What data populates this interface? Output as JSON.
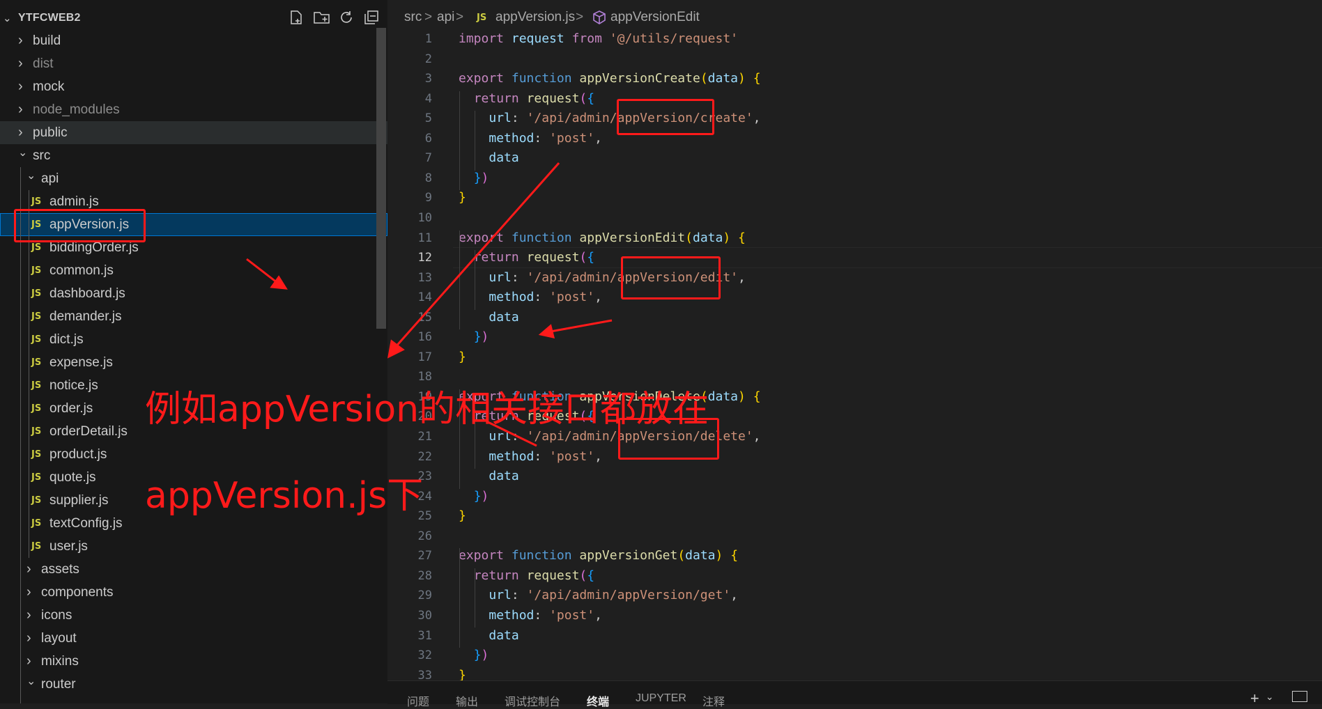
{
  "explorer": {
    "title": "YTFCWEB2",
    "actions": [
      "new-file-icon",
      "new-folder-icon",
      "refresh-icon",
      "collapse-all-icon"
    ],
    "items": [
      {
        "label": "build",
        "type": "folder",
        "expanded": false,
        "depth": 0
      },
      {
        "label": "dist",
        "type": "folder",
        "expanded": false,
        "depth": 0,
        "dim": true
      },
      {
        "label": "mock",
        "type": "folder",
        "expanded": false,
        "depth": 0
      },
      {
        "label": "node_modules",
        "type": "folder",
        "expanded": false,
        "depth": 0,
        "dim": true
      },
      {
        "label": "public",
        "type": "folder",
        "expanded": false,
        "depth": 0
      },
      {
        "label": "src",
        "type": "folder",
        "expanded": true,
        "depth": 0
      },
      {
        "label": "api",
        "type": "folder",
        "expanded": true,
        "depth": 1
      },
      {
        "label": "admin.js",
        "type": "js",
        "depth": 2
      },
      {
        "label": "appVersion.js",
        "type": "js",
        "depth": 2,
        "selected": true
      },
      {
        "label": "biddingOrder.js",
        "type": "js",
        "depth": 2
      },
      {
        "label": "common.js",
        "type": "js",
        "depth": 2
      },
      {
        "label": "dashboard.js",
        "type": "js",
        "depth": 2
      },
      {
        "label": "demander.js",
        "type": "js",
        "depth": 2
      },
      {
        "label": "dict.js",
        "type": "js",
        "depth": 2
      },
      {
        "label": "expense.js",
        "type": "js",
        "depth": 2
      },
      {
        "label": "notice.js",
        "type": "js",
        "depth": 2
      },
      {
        "label": "order.js",
        "type": "js",
        "depth": 2
      },
      {
        "label": "orderDetail.js",
        "type": "js",
        "depth": 2
      },
      {
        "label": "product.js",
        "type": "js",
        "depth": 2
      },
      {
        "label": "quote.js",
        "type": "js",
        "depth": 2
      },
      {
        "label": "supplier.js",
        "type": "js",
        "depth": 2
      },
      {
        "label": "textConfig.js",
        "type": "js",
        "depth": 2
      },
      {
        "label": "user.js",
        "type": "js",
        "depth": 2
      },
      {
        "label": "assets",
        "type": "folder",
        "expanded": false,
        "depth": 1
      },
      {
        "label": "components",
        "type": "folder",
        "expanded": false,
        "depth": 1
      },
      {
        "label": "icons",
        "type": "folder",
        "expanded": false,
        "depth": 1
      },
      {
        "label": "layout",
        "type": "folder",
        "expanded": false,
        "depth": 1
      },
      {
        "label": "mixins",
        "type": "folder",
        "expanded": false,
        "depth": 1
      },
      {
        "label": "router",
        "type": "folder",
        "expanded": true,
        "depth": 1
      }
    ],
    "js_badge": "JS",
    "icons": {
      "collapsed": "chevron-right-icon",
      "expanded": "chevron-down-icon",
      "file": "js-file-icon"
    }
  },
  "breadcrumb": {
    "parts": [
      "src",
      "api",
      "appVersion.js",
      "appVersionEdit"
    ],
    "separator": ">",
    "js_badge": "JS",
    "symbol_icon": "method-cube-icon"
  },
  "editor": {
    "current_line": 12,
    "lines": [
      [
        {
          "t": "import",
          "c": "k"
        },
        {
          "t": " request ",
          "c": "v"
        },
        {
          "t": "from",
          "c": "k"
        },
        {
          "t": " "
        },
        {
          "t": "'@/utils/request'",
          "c": "s"
        }
      ],
      [],
      [
        {
          "t": "export",
          "c": "k"
        },
        {
          "t": " "
        },
        {
          "t": "function",
          "c": "f"
        },
        {
          "t": " "
        },
        {
          "t": "appVersionCreate",
          "c": "fn"
        },
        {
          "t": "(",
          "c": "b1"
        },
        {
          "t": "data",
          "c": "v"
        },
        {
          "t": ")",
          "c": "b1"
        },
        {
          "t": " "
        },
        {
          "t": "{",
          "c": "b1"
        }
      ],
      [
        {
          "t": "  "
        },
        {
          "t": "return",
          "c": "k"
        },
        {
          "t": " "
        },
        {
          "t": "request",
          "c": "fn"
        },
        {
          "t": "(",
          "c": "b2"
        },
        {
          "t": "{",
          "c": "b3"
        }
      ],
      [
        {
          "t": "    "
        },
        {
          "t": "url",
          "c": "v"
        },
        {
          "t": ": "
        },
        {
          "t": "'/api/admin/appVersion/create'",
          "c": "s"
        },
        {
          "t": ","
        }
      ],
      [
        {
          "t": "    "
        },
        {
          "t": "method",
          "c": "v"
        },
        {
          "t": ": "
        },
        {
          "t": "'post'",
          "c": "s"
        },
        {
          "t": ","
        }
      ],
      [
        {
          "t": "    "
        },
        {
          "t": "data",
          "c": "v"
        }
      ],
      [
        {
          "t": "  "
        },
        {
          "t": "}",
          "c": "b3"
        },
        {
          "t": ")",
          "c": "b2"
        }
      ],
      [
        {
          "t": "}",
          "c": "b1"
        }
      ],
      [],
      [
        {
          "t": "export",
          "c": "k"
        },
        {
          "t": " "
        },
        {
          "t": "function",
          "c": "f"
        },
        {
          "t": " "
        },
        {
          "t": "appVersionEdit",
          "c": "fn"
        },
        {
          "t": "(",
          "c": "b1"
        },
        {
          "t": "data",
          "c": "v"
        },
        {
          "t": ")",
          "c": "b1"
        },
        {
          "t": " "
        },
        {
          "t": "{",
          "c": "b1"
        }
      ],
      [
        {
          "t": "  "
        },
        {
          "t": "return",
          "c": "k"
        },
        {
          "t": " "
        },
        {
          "t": "request",
          "c": "fn"
        },
        {
          "t": "(",
          "c": "b2"
        },
        {
          "t": "{",
          "c": "b3"
        }
      ],
      [
        {
          "t": "    "
        },
        {
          "t": "url",
          "c": "v"
        },
        {
          "t": ": "
        },
        {
          "t": "'/api/admin/appVersion/edit'",
          "c": "s"
        },
        {
          "t": ","
        }
      ],
      [
        {
          "t": "    "
        },
        {
          "t": "method",
          "c": "v"
        },
        {
          "t": ": "
        },
        {
          "t": "'post'",
          "c": "s"
        },
        {
          "t": ","
        }
      ],
      [
        {
          "t": "    "
        },
        {
          "t": "data",
          "c": "v"
        }
      ],
      [
        {
          "t": "  "
        },
        {
          "t": "}",
          "c": "b3"
        },
        {
          "t": ")",
          "c": "b2"
        }
      ],
      [
        {
          "t": "}",
          "c": "b1"
        }
      ],
      [],
      [
        {
          "t": "export",
          "c": "k"
        },
        {
          "t": " "
        },
        {
          "t": "function",
          "c": "f"
        },
        {
          "t": " "
        },
        {
          "t": "appVersionDelete",
          "c": "fn"
        },
        {
          "t": "(",
          "c": "b1"
        },
        {
          "t": "data",
          "c": "v"
        },
        {
          "t": ")",
          "c": "b1"
        },
        {
          "t": " "
        },
        {
          "t": "{",
          "c": "b1"
        }
      ],
      [
        {
          "t": "  "
        },
        {
          "t": "return",
          "c": "k"
        },
        {
          "t": " "
        },
        {
          "t": "request",
          "c": "fn"
        },
        {
          "t": "(",
          "c": "b2"
        },
        {
          "t": "{",
          "c": "b3"
        }
      ],
      [
        {
          "t": "    "
        },
        {
          "t": "url",
          "c": "v"
        },
        {
          "t": ": "
        },
        {
          "t": "'/api/admin/appVersion/delete'",
          "c": "s"
        },
        {
          "t": ","
        }
      ],
      [
        {
          "t": "    "
        },
        {
          "t": "method",
          "c": "v"
        },
        {
          "t": ": "
        },
        {
          "t": "'post'",
          "c": "s"
        },
        {
          "t": ","
        }
      ],
      [
        {
          "t": "    "
        },
        {
          "t": "data",
          "c": "v"
        }
      ],
      [
        {
          "t": "  "
        },
        {
          "t": "}",
          "c": "b3"
        },
        {
          "t": ")",
          "c": "b2"
        }
      ],
      [
        {
          "t": "}",
          "c": "b1"
        }
      ],
      [],
      [
        {
          "t": "export",
          "c": "k"
        },
        {
          "t": " "
        },
        {
          "t": "function",
          "c": "f"
        },
        {
          "t": " "
        },
        {
          "t": "appVersionGet",
          "c": "fn"
        },
        {
          "t": "(",
          "c": "b1"
        },
        {
          "t": "data",
          "c": "v"
        },
        {
          "t": ")",
          "c": "b1"
        },
        {
          "t": " "
        },
        {
          "t": "{",
          "c": "b1"
        }
      ],
      [
        {
          "t": "  "
        },
        {
          "t": "return",
          "c": "k"
        },
        {
          "t": " "
        },
        {
          "t": "request",
          "c": "fn"
        },
        {
          "t": "(",
          "c": "b2"
        },
        {
          "t": "{",
          "c": "b3"
        }
      ],
      [
        {
          "t": "    "
        },
        {
          "t": "url",
          "c": "v"
        },
        {
          "t": ": "
        },
        {
          "t": "'/api/admin/appVersion/get'",
          "c": "s"
        },
        {
          "t": ","
        }
      ],
      [
        {
          "t": "    "
        },
        {
          "t": "method",
          "c": "v"
        },
        {
          "t": ": "
        },
        {
          "t": "'post'",
          "c": "s"
        },
        {
          "t": ","
        }
      ],
      [
        {
          "t": "    "
        },
        {
          "t": "data",
          "c": "v"
        }
      ],
      [
        {
          "t": "  "
        },
        {
          "t": "}",
          "c": "b3"
        },
        {
          "t": ")",
          "c": "b2"
        }
      ],
      [
        {
          "t": "}",
          "c": "b1"
        }
      ]
    ]
  },
  "panel": {
    "tabs": [
      "问题",
      "输出",
      "调试控制台",
      "终端",
      "JUPYTER",
      "注释"
    ],
    "active_tab": "终端",
    "actions": [
      "plus-icon",
      "chevron-down-icon",
      "terminal-icon"
    ]
  },
  "annotations": {
    "line1": "例如appVersion的相关接口都放在",
    "line2": "appVersion.js下"
  },
  "colors": {
    "keyword": "#c586c0",
    "storage": "#569cd6",
    "function": "#dcdcaa",
    "variable": "#9cdcfe",
    "string": "#ce9178",
    "annotation_red": "#ff1a1a",
    "selection": "#04395e",
    "js_icon": "#cbcb41"
  }
}
